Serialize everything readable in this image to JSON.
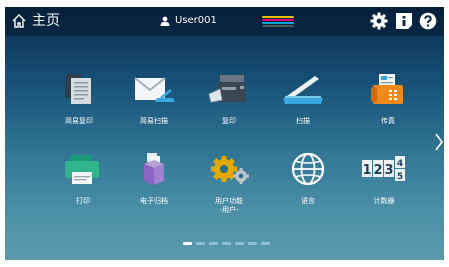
{
  "header": {
    "title": "主页",
    "user": "User001"
  },
  "toner_colors": [
    "#f0c000",
    "#e0007a",
    "#00a6e0",
    "#2a2a2a"
  ],
  "tiles": [
    {
      "label": "简易复印",
      "icon": "easy-copy-icon"
    },
    {
      "label": "简易扫描",
      "icon": "easy-scan-icon"
    },
    {
      "label": "复印",
      "icon": "copy-icon"
    },
    {
      "label": "扫描",
      "icon": "scan-icon"
    },
    {
      "label": "传真",
      "icon": "fax-icon"
    },
    {
      "label": "打印",
      "icon": "print-icon"
    },
    {
      "label": "电子归档",
      "icon": "e-filing-icon"
    },
    {
      "label": "用户功能",
      "sublabel": "-用户-",
      "icon": "user-functions-icon"
    },
    {
      "label": "语言",
      "icon": "language-icon"
    },
    {
      "label": "计数器",
      "icon": "counter-icon"
    }
  ],
  "counter_digits": [
    "1",
    "2",
    "3",
    "4",
    "5"
  ],
  "pagination": {
    "current": 1,
    "total": 7
  },
  "colors": {
    "accent": "#3aa8e0",
    "topbar": "#0a2440"
  }
}
